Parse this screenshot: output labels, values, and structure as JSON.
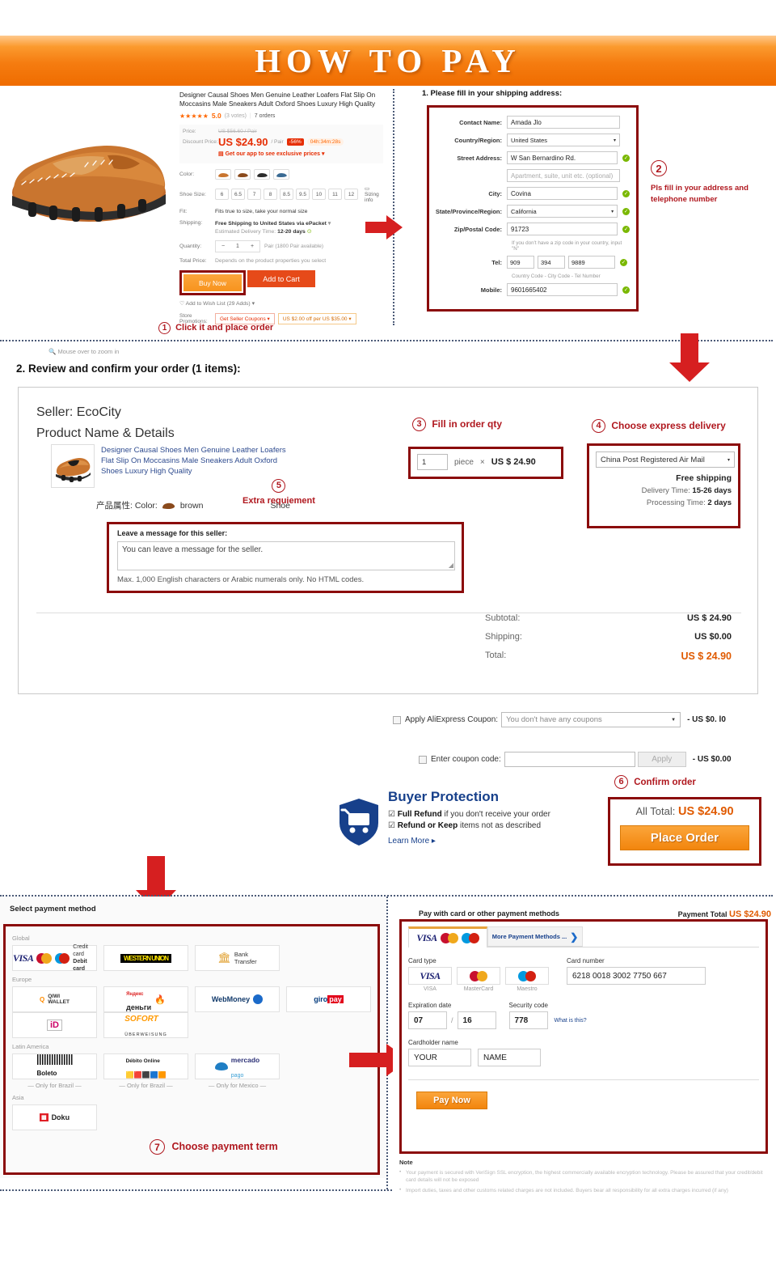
{
  "banner": {
    "title": "HOW TO PAY"
  },
  "product": {
    "title": "Designer Causal Shoes Men Genuine Leather Loafers Flat Slip On Moccasins Male Sneakers Adult Oxford Shoes Luxury High Quality",
    "stars": "★★★★★",
    "rating": "5.0",
    "votes": "(3 votes)",
    "orders": "7 orders",
    "zoom_hint": "Mouse over to zoom in",
    "price_label": "Price:",
    "price_old": "US $56.60 / Pair",
    "discount_label": "Discount Price:",
    "price_now": "US $24.90",
    "per_unit": "/ Pair",
    "discount_tag": "-56%",
    "timer": "04h:34m:28s",
    "app_link": "Get our app to see exclusive prices",
    "color_label": "Color:",
    "size_label": "Shoe Size:",
    "sizes": [
      "6",
      "6.5",
      "7",
      "8",
      "8.5",
      "9.5",
      "10",
      "11",
      "12"
    ],
    "sizing_info": "Sizing info",
    "fit_label": "Fit:",
    "fit_value": "Fits true to size, take your normal size",
    "shipping_label": "Shipping:",
    "shipping_value": "Free Shipping to United States via ePacket",
    "delivery_estimate_label": "Estimated Delivery Time:",
    "delivery_estimate_value": "12-20 days",
    "qty_label": "Quantity:",
    "qty_value": "1",
    "qty_avail": "Pair (1800 Pair available)",
    "total_price_label": "Total Price:",
    "total_price_value": "Depends on the product properties you select",
    "buy_now": "Buy Now",
    "add_to_cart": "Add to Cart",
    "wish": "Add to Wish List (29 Adds)",
    "store_promo_label": "Store Promotions:",
    "promo1": "Get Seller Coupons",
    "promo2": "US $2.00 off per US $35.00"
  },
  "step1": {
    "num": "1",
    "text": "Click it and place order"
  },
  "shipping_form": {
    "title": "1. Please fill in your shipping address:",
    "fields": [
      {
        "label": "Contact Name:",
        "value": "Amada  Jlo",
        "type": "text",
        "check": false
      },
      {
        "label": "Country/Region:",
        "value": "United States",
        "type": "select",
        "check": false
      },
      {
        "label": "Street Address:",
        "value": "W San Bernardino Rd.",
        "type": "text",
        "check": true
      },
      {
        "label": "",
        "value": "Apartment, suite, unit etc. (optional)",
        "type": "placeholder",
        "check": false
      },
      {
        "label": "City:",
        "value": "Covina",
        "type": "text",
        "check": true
      },
      {
        "label": "State/Province/Region:",
        "value": "California",
        "type": "select",
        "check": true
      },
      {
        "label": "Zip/Postal Code:",
        "value": "91723",
        "type": "text",
        "check": true
      }
    ],
    "zip_hint": "If you don't have a zip code in your country, input \"N\"",
    "tel_label": "Tel:",
    "tel_country": "909",
    "tel_city": "394",
    "tel_number": "9889",
    "tel_hint": "Country Code - City Code - Tel Number",
    "mobile_label": "Mobile:",
    "mobile_value": "9601665402"
  },
  "step2": {
    "num": "2",
    "text": "Pls fill in your address and telephone number"
  },
  "section2": {
    "title": "2. Review and confirm your order (1 items):",
    "seller": "Seller: EcoCity",
    "product_name_details": "Product Name & Details",
    "product_link": "Designer Causal Shoes Men Genuine Leather Loafers Flat Slip On Moccasins Male Sneakers Adult Oxford Shoes Luxury High Quality",
    "attributes": "产品属性: Color:",
    "attr_color": "brown",
    "attr_type": "Shoe"
  },
  "step3": {
    "num": "3",
    "text": "Fill in order qty"
  },
  "qty": {
    "value": "1",
    "unit": "piece",
    "times": "×",
    "price": "US $ 24.90"
  },
  "step4": {
    "num": "4",
    "text": "Choose express delivery"
  },
  "delivery": {
    "carrier": "China Post Registered Air Mail",
    "free_shipping": "Free shipping",
    "delivery_time_label": "Delivery Time:",
    "delivery_time_value": "15-26 days",
    "processing_time_label": "Processing Time:",
    "processing_time_value": "2 days"
  },
  "step5": {
    "num": "5",
    "text": "Extra requiement"
  },
  "message": {
    "label": "Leave a message for this seller:",
    "placeholder": "You can leave a message for the seller.",
    "hint": "Max. 1,000 English characters or Arabic numerals only. No HTML codes."
  },
  "totals": [
    {
      "label": "Subtotal:",
      "value": "US $ 24.90",
      "grand": false
    },
    {
      "label": "Shipping:",
      "value": "US $0.00",
      "grand": false
    },
    {
      "label": "Total:",
      "value": "US $ 24.90",
      "grand": true
    }
  ],
  "coupons": {
    "apply_label": "Apply AliExpress Coupon:",
    "apply_select": "You don't have any coupons",
    "apply_amount": "- US $0. l0",
    "code_label": "Enter coupon code:",
    "code_value": "",
    "apply_button": "Apply",
    "code_amount": "- US $0.00"
  },
  "buyer_protection": {
    "title": "Buyer Protection",
    "line1_bold": "Full Refund",
    "line1_rest": " if you don't receive your order",
    "line2_bold": "Refund or Keep",
    "line2_rest": " items not as described",
    "learn_more": "Learn More ▸"
  },
  "step6": {
    "num": "6",
    "text": "Confirm order"
  },
  "confirm": {
    "all_total_label": "All Total:",
    "all_total_value": "US $24.90",
    "place_order": "Place Order"
  },
  "payment_select": {
    "title": "Select payment method",
    "groups": [
      {
        "region": "Global",
        "tiles": [
          {
            "kind": "cards",
            "label": "Credit card\nDebit card",
            "note": ""
          },
          {
            "kind": "union",
            "label": "UNION",
            "note": ""
          },
          {
            "kind": "bank",
            "label": "Bank\nTransfer",
            "note": ""
          }
        ]
      },
      {
        "region": "Europe",
        "tiles": [
          {
            "kind": "qiwi",
            "label": "QIWI\nWALLET",
            "note": ""
          },
          {
            "kind": "yandex",
            "label": "деньги",
            "note": ""
          },
          {
            "kind": "webmoney",
            "label": "WebMoney",
            "note": ""
          },
          {
            "kind": "giropay",
            "label": "giropay",
            "note": ""
          },
          {
            "kind": "ideal",
            "label": "iD",
            "note": ""
          },
          {
            "kind": "sofort",
            "label": "SOFORT",
            "note": ""
          }
        ]
      },
      {
        "region": "Latin America",
        "tiles": [
          {
            "kind": "boleto",
            "label": "Boleto",
            "note": "Only for Brazil"
          },
          {
            "kind": "debito",
            "label": "Débito Online",
            "note": "Only for Brazil"
          },
          {
            "kind": "mercado",
            "label": "mercado pago",
            "note": "Only for Mexico"
          }
        ]
      },
      {
        "region": "Asia",
        "tiles": [
          {
            "kind": "doku",
            "label": "Doku",
            "note": ""
          }
        ]
      }
    ]
  },
  "step7": {
    "num": "7",
    "text": "Choose payment term"
  },
  "card_panel": {
    "title": "Pay with card or other payment methods",
    "payment_total_label": "Payment Total",
    "payment_total_value": "US $24.90",
    "tab_more": "More Payment Methods ...",
    "card_type_label": "Card type",
    "card_types": [
      "VISA",
      "MasterCard",
      "Maestro"
    ],
    "card_number_label": "Card number",
    "card_number_value": "6218 0018 3002 7750 667",
    "expiration_label": "Expiration date",
    "exp_month": "07",
    "exp_sep": "/",
    "exp_year": "16",
    "security_label": "Security code",
    "security_value": "778",
    "what_is_this": "What is this?",
    "cardholder_label": "Cardholder name",
    "cardholder_first": "YOUR",
    "cardholder_last": "NAME",
    "pay_now": "Pay Now",
    "note_title": "Note",
    "notes": [
      "Your payment is secured with VeriSign SSL encryption, the highest commercially available encryption technology. Please be assured that your credit/debit card details will not be exposed",
      "Import duties, taxes and other customs related charges are not included. Buyers bear all responsibility for all extra charges incurred (if any)"
    ]
  }
}
